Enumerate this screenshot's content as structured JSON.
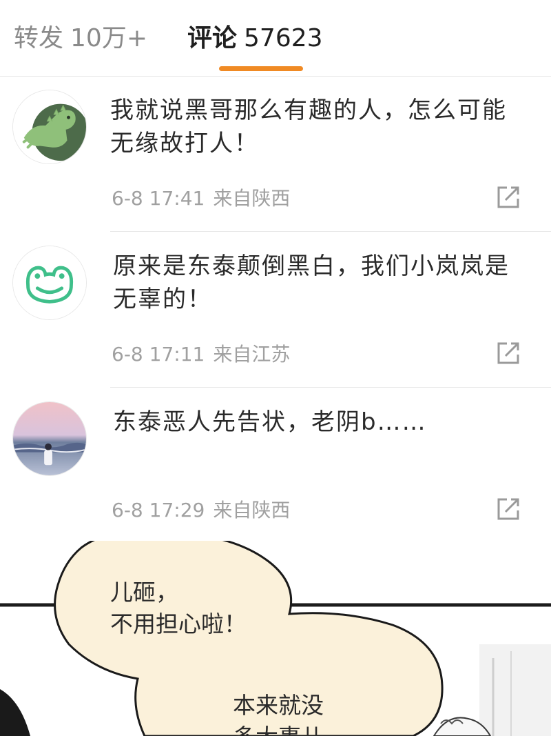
{
  "tabs": {
    "repost": {
      "label": "转发",
      "count": "10万+"
    },
    "comments": {
      "label": "评论",
      "count": "57623"
    }
  },
  "comments": [
    {
      "text": "我就说黑哥那么有趣的人，怎么可能无缘故打人！",
      "time": "6-8 17:41",
      "location": "来自陕西",
      "avatar": "dinosaur-avatar"
    },
    {
      "text": "原来是东泰颠倒黑白，我们小岚岚是无辜的！",
      "time": "6-8 17:11",
      "location": "来自江苏",
      "avatar": "frog-avatar"
    },
    {
      "text": "东泰恶人先告状，老阴b……",
      "time": "6-8 17:29",
      "location": "来自陕西",
      "avatar": "seaside-photo-avatar"
    }
  ],
  "comic": {
    "bubble1_line1": "儿砸，",
    "bubble1_line2": "不用担心啦！",
    "bubble2_line1": "本来就没",
    "bubble2_line2": "多大事儿~"
  },
  "colors": {
    "accent": "#f08a24",
    "bubble_fill": "#fbf1da",
    "muted_text": "#a0a0a0"
  }
}
